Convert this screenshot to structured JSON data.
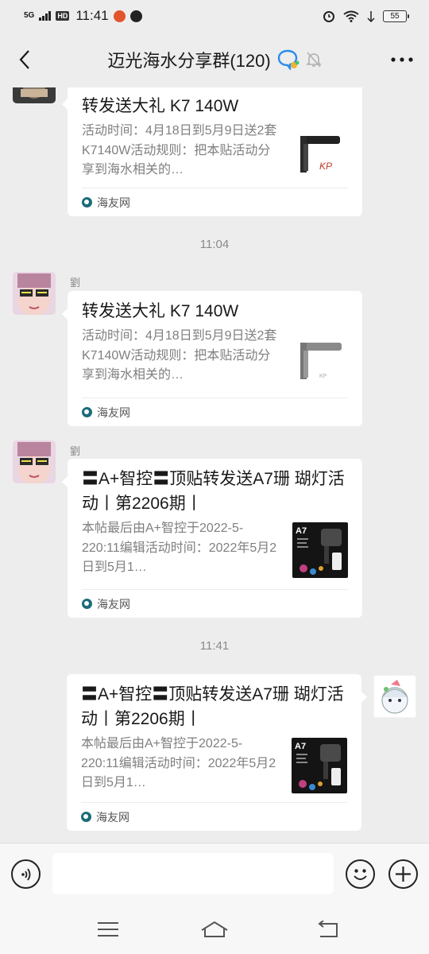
{
  "status_bar": {
    "network": "5G",
    "hd": "HD",
    "time": "11:41",
    "battery": "55"
  },
  "header": {
    "title": "迈光海水分享群(120)",
    "icons": [
      "back-arrow-icon",
      "chat-bubble-icon",
      "mute-bell-icon",
      "more-dots-icon"
    ]
  },
  "messages": [
    {
      "title": "转发送大礼 K7 140W",
      "description": "活动时间：4月18日到5月9日送2套K7140W活动规则：把本贴活动分享到海水相关的…",
      "source": "海友网"
    },
    {
      "sender": "劉",
      "title": "转发送大礼 K7 140W",
      "description": "活动时间：4月18日到5月9日送2套K7140W活动规则：把本贴活动分享到海水相关的…",
      "source": "海友网"
    },
    {
      "sender": "劉",
      "title": "〓A+智控〓顶贴转发送A7珊 瑚灯活动丨第2206期丨",
      "description": "本帖最后由A+智控于2022-5-220:11编辑活动时间：2022年5月2日到5月1…",
      "source": "海友网"
    },
    {
      "title": "〓A+智控〓顶贴转发送A7珊 瑚灯活动丨第2206期丨",
      "description": "本帖最后由A+智控于2022-5-220:11编辑活动时间：2022年5月2日到5月1…",
      "source": "海友网"
    }
  ],
  "time_labels": [
    "11:04",
    "11:41"
  ],
  "thumb_text": {
    "a7": "A7"
  },
  "input_bar": {
    "placeholder": "",
    "icons": [
      "voice-icon",
      "emoji-icon",
      "plus-icon"
    ]
  },
  "nav_bar": {
    "icons": [
      "menu-icon",
      "home-icon",
      "back-icon"
    ]
  },
  "colors": {
    "background": "#ededed",
    "card": "#ffffff",
    "source_icon": "#1c6b78"
  }
}
